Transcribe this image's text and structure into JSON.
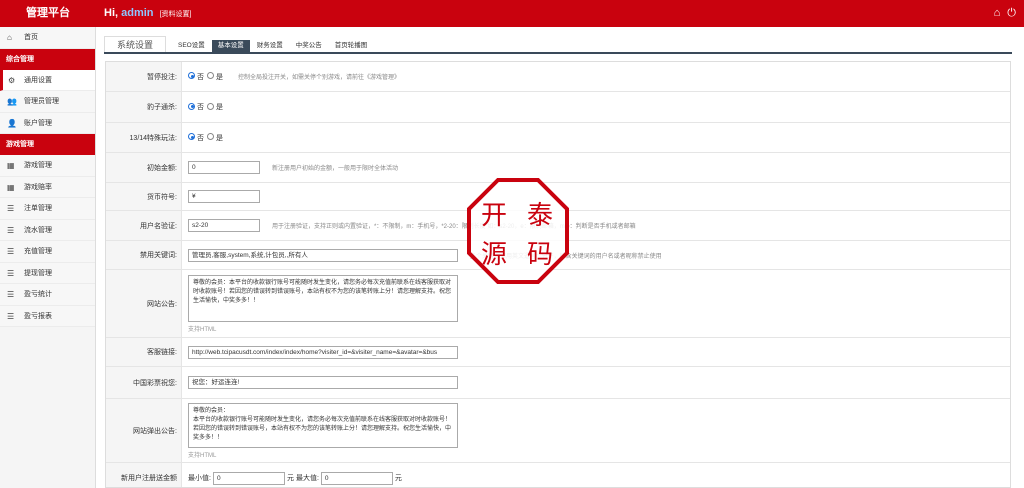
{
  "header": {
    "brand": "管理平台",
    "hi": "Hi,",
    "username": "admin",
    "profile_link": "[资料设置]",
    "home_icon": "home-icon",
    "power_icon": "power-icon"
  },
  "sidebar": {
    "home": "首页",
    "section1": "综合管理",
    "items1": [
      "通用设置",
      "管理员管理",
      "账户管理"
    ],
    "section2": "游戏管理",
    "items2": [
      "游戏管理",
      "游戏赔率",
      "注单管理",
      "流水管理",
      "充值管理",
      "提现管理",
      "盈亏统计",
      "盈亏报表"
    ]
  },
  "tabs": [
    "系统设置",
    "SEO设置",
    "基本设置",
    "财务设置",
    "中奖公告",
    "首页轮播图"
  ],
  "form": {
    "pause": {
      "label": "暂停投注:",
      "opt_no": "否",
      "opt_yes": "是",
      "hint": "控制全局投注开关，如需关停个别游戏，请前往《游戏管理》"
    },
    "leopard": {
      "label": "豹子通杀:",
      "opt_no": "否",
      "opt_yes": "是"
    },
    "special": {
      "label": "13/14特殊玩法:",
      "opt_no": "否",
      "opt_yes": "是"
    },
    "init_amount": {
      "label": "初始金额:",
      "value": "0",
      "hint": "新注册用户初始的金额，一般用于限时全体活动"
    },
    "currency": {
      "label": "货币符号:",
      "value": "¥"
    },
    "username_verify": {
      "label": "用户名验证:",
      "value": "s2-20",
      "hint": "用于注册验证，支持正则或内置验证，*：不限制，m：手机号，*2-20：限制长度 如：s2-20，e：限制邮箱，m|e：判断是否手机或者邮箱"
    },
    "banned": {
      "label": "禁用关键词:",
      "value": "管理员,客服,system,系统,计包员,,所有人",
      "hint": "多个关键词请用英文逗号“,”分开，检含关键词的用户名或者昵称禁止使用"
    },
    "notice": {
      "label": "网站公告:",
      "value": "尊敬的会员：本平台的收款银行账号可能随时发生变化，请您务必每次充值前联系在线客服获取对时收款账号！若因您的错误转到错误账号，本站有权不为您的该笔转账上分！请您理解支持。祝您生活愉快，中奖多多！！",
      "sub": "支持HTML"
    },
    "service": {
      "label": "客服链接:",
      "value": "http://web.tcipacusdt.com/index/index/home?visiter_id=&visiter_name=&avatar=&bus"
    },
    "wish": {
      "label": "中国彩票祝您:",
      "value": "祝您：好运连连!"
    },
    "popup": {
      "label": "网站弹出公告:",
      "value": "尊敬的会员：\n本平台的收款银行账号可能随时发生变化，请您务必每次充值前联系在线客服获取对时收款账号！若因您的错误转到错误账号，本站有权不为您的该笔转账上分！请您理解支持。祝您生活愉快，中奖多多！！",
      "sub": "支持HTML"
    },
    "bonus": {
      "label": "新用户注册送金额",
      "min_label": "最小值:",
      "min_value": "0",
      "unit1": "元",
      "max_label": "最大值:",
      "max_value": "0",
      "unit2": "元"
    }
  },
  "stamp": {
    "chars": [
      "开",
      "泰",
      "源",
      "码"
    ]
  },
  "colors": {
    "brand_red": "#c9020e",
    "tab_dark": "#3a4a5a",
    "radio_blue": "#1e6fd9"
  }
}
